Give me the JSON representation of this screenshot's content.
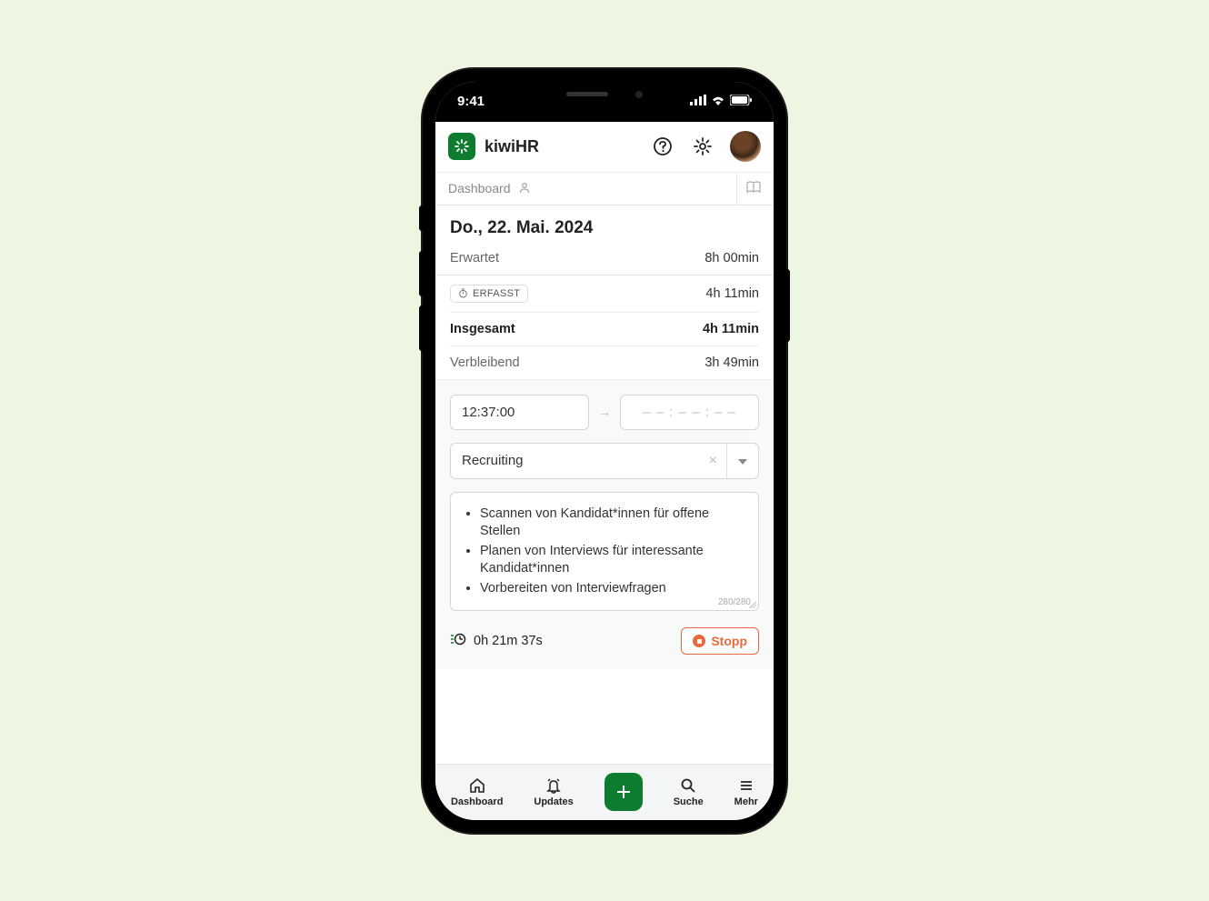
{
  "status_bar": {
    "time": "9:41"
  },
  "brand": "kiwiHR",
  "subheader": {
    "title": "Dashboard"
  },
  "date": "Do., 22. Mai. 2024",
  "summary": {
    "expected_label": "Erwartet",
    "expected_value": "8h 00min",
    "tracked_chip": "ERFASST",
    "tracked_value": "4h 11min",
    "total_label": "Insgesamt",
    "total_value": "4h 11min",
    "remaining_label": "Verbleibend",
    "remaining_value": "3h 49min"
  },
  "form": {
    "start_time": "12:37:00",
    "end_placeholder": "– – : – – : – –",
    "project": "Recruiting",
    "notes": [
      "Scannen von Kandidat*innen für offene Stellen",
      "Planen von Interviews für interessante Kandidat*innen",
      "Vorbereiten von Interviewfragen"
    ],
    "char_count": "280/280"
  },
  "timer": {
    "elapsed": "0h 21m 37s",
    "stop_label": "Stopp"
  },
  "nav": {
    "dashboard": "Dashboard",
    "updates": "Updates",
    "search": "Suche",
    "more": "Mehr"
  }
}
